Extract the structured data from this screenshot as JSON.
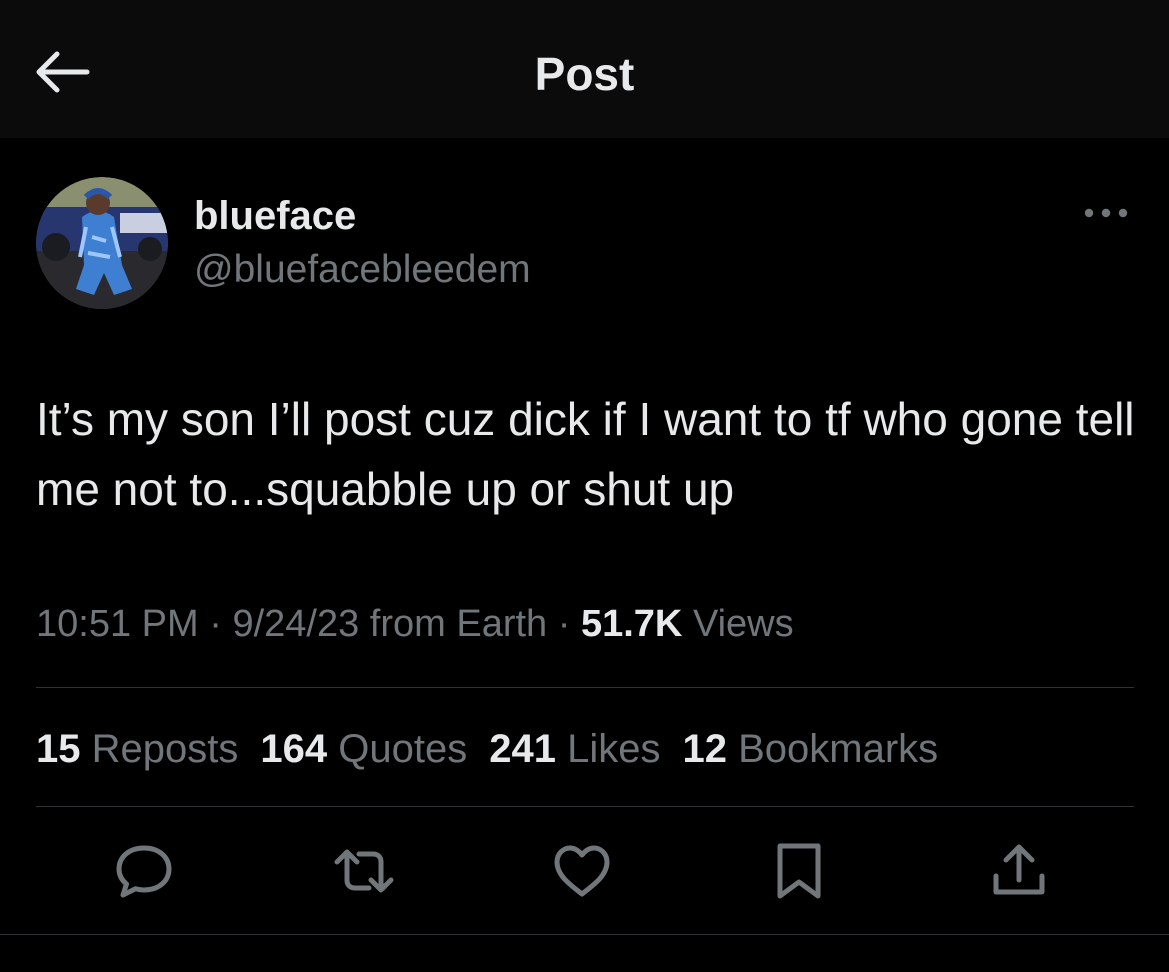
{
  "header": {
    "title": "Post",
    "back_icon": "arrow-left-icon"
  },
  "author": {
    "display_name": "blueface",
    "handle": "@bluefacebleedem",
    "avatar": "profile-photo",
    "more_icon": "more-horizontal-icon"
  },
  "post": {
    "text": "It’s my son I’ll post cuz dick if I want to tf who gone tell me not to...squabble up or shut up"
  },
  "meta": {
    "time": "10:51 PM",
    "sep1": "·",
    "date": "9/24/23",
    "source": "from Earth",
    "sep2": "·",
    "views_count": "51.7K",
    "views_label": "Views"
  },
  "stats": [
    {
      "count": "15",
      "label": "Reposts"
    },
    {
      "count": "164",
      "label": "Quotes"
    },
    {
      "count": "241",
      "label": "Likes"
    },
    {
      "count": "12",
      "label": "Bookmarks"
    }
  ],
  "actions": [
    {
      "icon": "reply-icon"
    },
    {
      "icon": "repost-icon"
    },
    {
      "icon": "like-icon"
    },
    {
      "icon": "bookmark-icon"
    },
    {
      "icon": "share-icon"
    }
  ],
  "colors": {
    "background": "#000000",
    "header_bg": "#0b0b0b",
    "text_primary": "#e7e9ea",
    "text_secondary": "#71767b",
    "divider": "#2f3336"
  }
}
